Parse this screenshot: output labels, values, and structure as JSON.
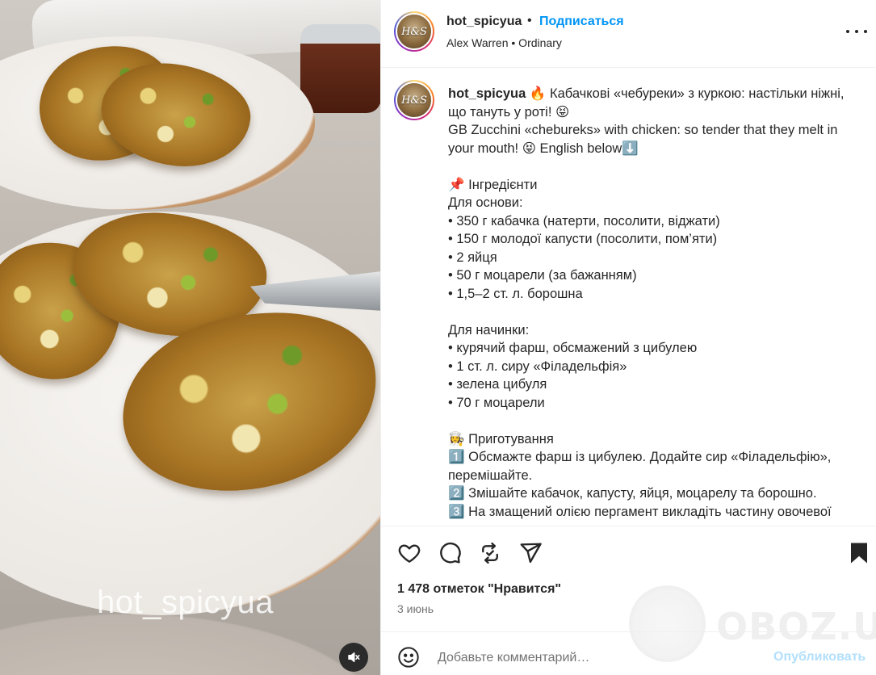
{
  "post": {
    "image": {
      "watermark": "hot_spicyua",
      "mute_icon": "speaker-muted-icon"
    },
    "header": {
      "username": "hot_spicyua",
      "dot": "•",
      "follow_label": "Подписаться",
      "subtitle": "Alex Warren • Ordinary",
      "avatar_label": "H&S",
      "more_icon": "more-horizontal-icon"
    },
    "caption": {
      "username": "hot_spicyua",
      "lines": [
        "🔥 Кабачкові «чебуреки» з куркою: настільки ніжні, що тануть у роті! 😝",
        "GB Zucchini «chebureks» with chicken: so tender that they melt in your mouth! 😝 English below⬇️",
        "",
        "📌 Інгредієнти",
        "Для основи:",
        "• 350 г кабачка (натерти, посолити, віджати)",
        "• 150 г молодої капусти (посолити, пом’яти)",
        "• 2 яйця",
        "• 50 г моцарели (за бажанням)",
        "• 1,5–2 ст. л. борошна",
        "",
        "Для начинки:",
        "• курячий фарш, обсмажений з цибулею",
        "• 1 ст. л. сиру «Філадельфія»",
        "• зелена цибуля",
        "• 70 г моцарели",
        "",
        "👩‍🍳 Приготування",
        "1️⃣ Обсмажте фарш із цибулею. Додайте сир «Філадельфію», перемішайте.",
        "2️⃣ Змішайте кабачок, капусту, яйця, моцарелу та борошно.",
        "3️⃣ На змащений олією пергамент викладіть частину овочевої"
      ]
    },
    "actions": {
      "like_icon": "heart-icon",
      "comment_icon": "comment-bubble-icon",
      "repost_icon": "repost-icon",
      "share_icon": "send-plane-icon",
      "save_icon": "bookmark-icon"
    },
    "likes_text": "1 478 отметок \"Нравится\"",
    "date_text": "3 июнь",
    "comment": {
      "placeholder": "Добавьте комментарий…",
      "post_label": "Опубликовать",
      "emoji_icon": "smiley-icon"
    },
    "watermark_brand": "OBOZ.UA"
  },
  "colors": {
    "accent": "#0095f6",
    "post_disabled": "#b2dffc",
    "text": "#262626",
    "muted": "#737373",
    "divider": "#efefef"
  }
}
